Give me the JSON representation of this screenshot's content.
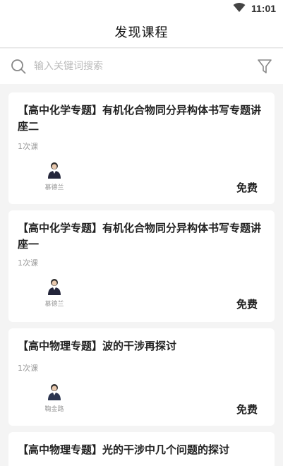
{
  "status_bar": {
    "time": "11:01",
    "wifi_icon": "wifi-icon"
  },
  "header": {
    "title": "发现课程"
  },
  "search": {
    "placeholder": "输入关键词搜索",
    "search_icon": "search-icon",
    "filter_icon": "filter-icon"
  },
  "courses": [
    {
      "title": "【高中化学专题】有机化合物同分异构体书写专题讲座二",
      "lessons": "1次课",
      "teacher": "慕德兰",
      "price": "免费"
    },
    {
      "title": "【高中化学专题】有机化合物同分异构体书写专题讲座一",
      "lessons": "1次课",
      "teacher": "慕德兰",
      "price": "免费"
    },
    {
      "title": "【高中物理专题】波的干涉再探讨",
      "lessons": "1次课",
      "teacher": "鞠金路",
      "price": "免费"
    },
    {
      "title": "【高中物理专题】光的干涉中几个问题的探讨",
      "lessons": "",
      "teacher": "",
      "price": ""
    }
  ]
}
